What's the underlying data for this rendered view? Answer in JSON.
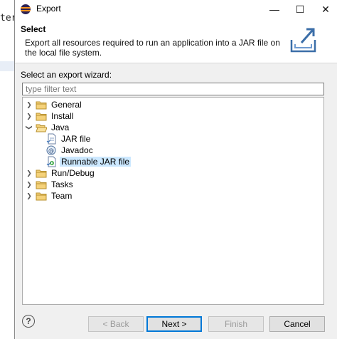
{
  "background": {
    "fragment_text": "ter"
  },
  "window": {
    "title": "Export",
    "minimize_glyph": "—",
    "maximize_glyph": "☐",
    "close_glyph": "✕"
  },
  "banner": {
    "heading": "Select",
    "description": "Export all resources required to run an application into a JAR file on the local file system."
  },
  "wizard": {
    "label": "Select an export wizard:",
    "filter_placeholder": "type filter text"
  },
  "tree": {
    "items": [
      {
        "label": "General",
        "icon": "folder-icon",
        "expanded": false
      },
      {
        "label": "Install",
        "icon": "folder-icon",
        "expanded": false
      },
      {
        "label": "Java",
        "icon": "folder-icon",
        "expanded": true
      },
      {
        "label": "JAR file",
        "icon": "jar-file-icon"
      },
      {
        "label": "Javadoc",
        "icon": "javadoc-icon"
      },
      {
        "label": "Runnable JAR file",
        "icon": "runnable-jar-icon",
        "selected": true
      },
      {
        "label": "Run/Debug",
        "icon": "folder-icon",
        "expanded": false
      },
      {
        "label": "Tasks",
        "icon": "folder-icon",
        "expanded": false
      },
      {
        "label": "Team",
        "icon": "folder-icon",
        "expanded": false
      }
    ]
  },
  "buttons": {
    "help": "?",
    "back": "< Back",
    "next": "Next >",
    "finish": "Finish",
    "cancel": "Cancel"
  },
  "colors": {
    "selection": "#cce8ff",
    "default_button_border": "#0078d7",
    "folder": "#e8b84a"
  }
}
